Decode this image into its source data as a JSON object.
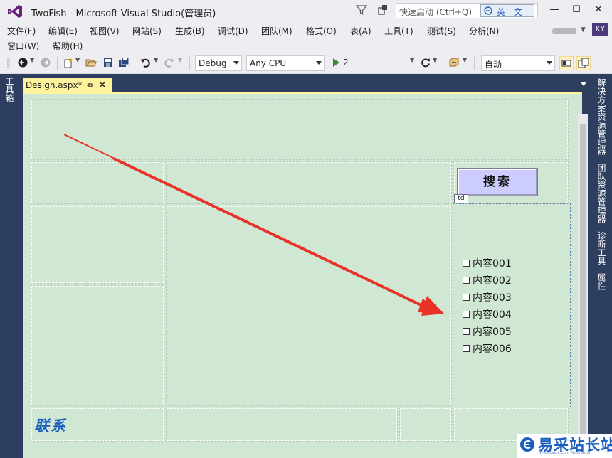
{
  "window": {
    "title": "TwoFish - Microsoft Visual Studio(管理员)",
    "quick_launch_placeholder": "快速启动 (Ctrl+Q)",
    "ime_label": "英 文",
    "minimize": "—",
    "maximize": "☐",
    "close": "✕",
    "user_initials": "XY"
  },
  "menu": {
    "row1": [
      "文件(F)",
      "编辑(E)",
      "视图(V)",
      "网站(S)",
      "生成(B)",
      "调试(D)",
      "团队(M)",
      "格式(O)",
      "表(A)",
      "工具(T)",
      "测试(S)",
      "分析(N)"
    ],
    "row2": [
      "窗口(W)",
      "帮助(H)"
    ]
  },
  "toolbar": {
    "configuration": "Debug",
    "platform": "Any CPU",
    "run_prefix": "2",
    "layout_combo": "自动"
  },
  "side_panels": {
    "left": "工具箱",
    "right": [
      "解决方案资源管理器",
      "团队资源管理器",
      "诊断工具",
      "属性"
    ]
  },
  "document_tab": {
    "label": "Design.aspx*"
  },
  "design": {
    "search_button": "搜索",
    "td_tag": "td",
    "checkboxes": [
      "内容001",
      "内容002",
      "内容003",
      "内容004",
      "内容005",
      "内容006"
    ],
    "contact_text": "联系"
  },
  "watermark": {
    "text": "易采站长站",
    "subtext": "Www.Easck.Com Webmaster"
  },
  "colors": {
    "design_bg": "#d0e8d3",
    "ide_dark": "#2d3e5f",
    "tab_yellow": "#fff29d",
    "arrow": "#e8322a",
    "search_button": "#ccccff",
    "contact_blue": "#1a5fc0"
  }
}
